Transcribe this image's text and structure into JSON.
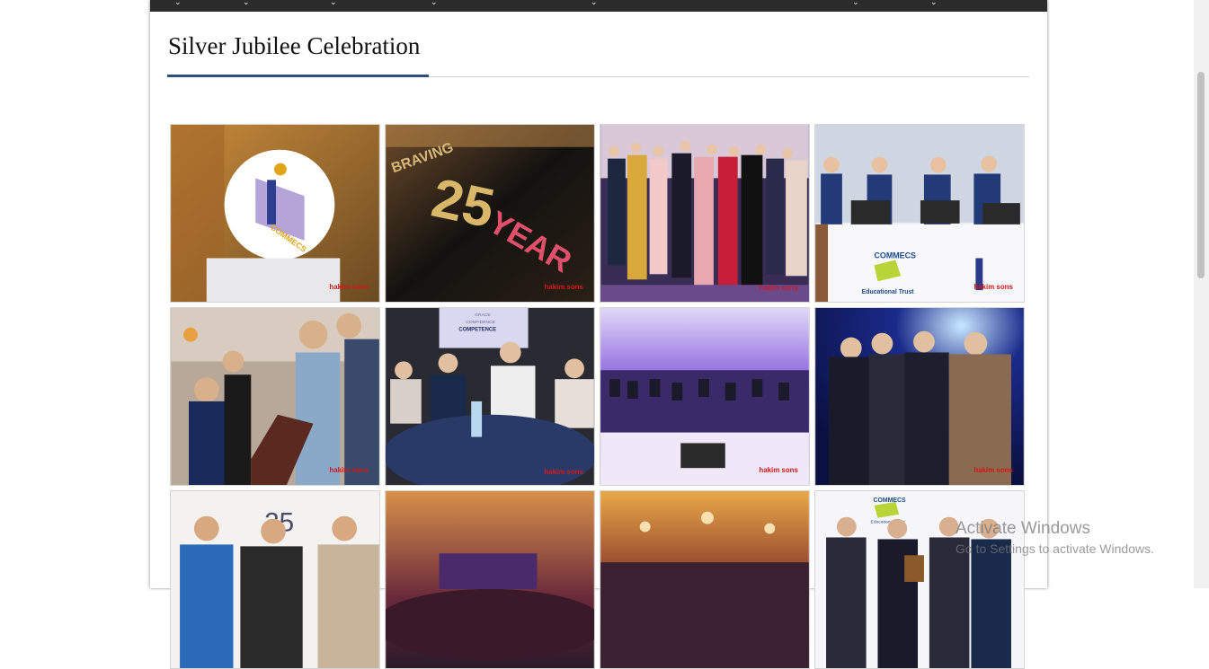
{
  "page": {
    "title": "Silver Jubilee Celebration"
  },
  "nav": {
    "caret_glyph": "⌄"
  },
  "gallery": {
    "photos": [
      {
        "subject": "COMMECS logo sculpture",
        "logo_text": "COMMECS",
        "watermark": "hakim sons"
      },
      {
        "subject": "25 YEAR sign close-up",
        "sign_text_top": "BRAVING",
        "sign_number": "25",
        "sign_word": "YEAR",
        "watermark": "hakim sons"
      },
      {
        "subject": "Group of students posing",
        "watermark": "hakim sons"
      },
      {
        "subject": "Students at laptops on stage",
        "banner_text": "COMMECS",
        "banner_sub": "Educational Trust",
        "watermark": "hakim sons"
      },
      {
        "subject": "Guests using laptops",
        "watermark": "hakim sons"
      },
      {
        "subject": "Guests seated at dinner table",
        "screen_text_1": "GRACE",
        "screen_text_2": "CONFIDENCE",
        "screen_text_3": "COMPETENCE",
        "watermark": "hakim sons"
      },
      {
        "subject": "Audience hall with purple lighting",
        "watermark": "hakim sons"
      },
      {
        "subject": "Award handshake on stage",
        "watermark": "hakim sons"
      },
      {
        "subject": "Three men posing",
        "backdrop_number": "25"
      },
      {
        "subject": "Banquet hall with stage"
      },
      {
        "subject": "Crowded banquet hall"
      },
      {
        "subject": "Award presentation with trophy",
        "backdrop_text": "COMMECS",
        "backdrop_sub": "Educational Trust"
      }
    ]
  },
  "os_overlay": {
    "line1": "Activate Windows",
    "line2": "Go to Settings to activate Windows."
  },
  "colors": {
    "title_underline": "#2d4e7e",
    "nav_bg": "#2b2b2b",
    "watermark": "#d01818"
  }
}
